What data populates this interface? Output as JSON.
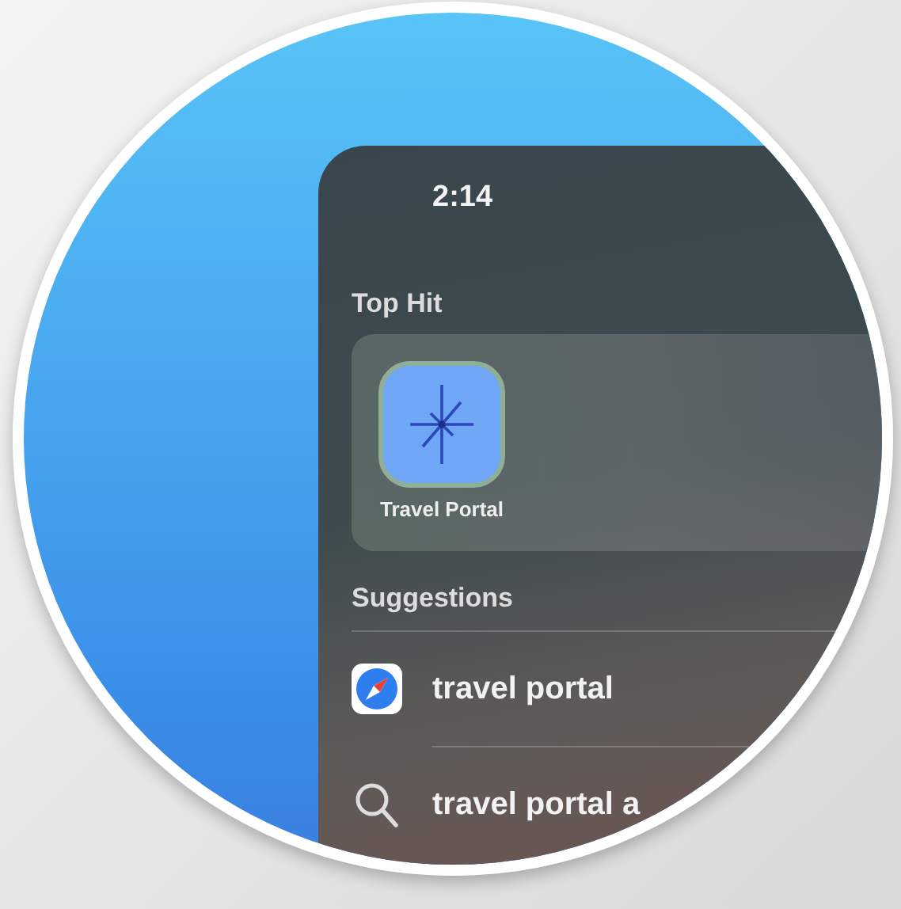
{
  "status_bar": {
    "time": "2:14"
  },
  "top_hit": {
    "heading": "Top Hit",
    "app": {
      "label": "Travel Portal"
    }
  },
  "suggestions": {
    "heading": "Suggestions",
    "items": [
      {
        "kind": "safari",
        "text": "travel portal"
      },
      {
        "kind": "search",
        "text": "travel portal a"
      }
    ]
  }
}
